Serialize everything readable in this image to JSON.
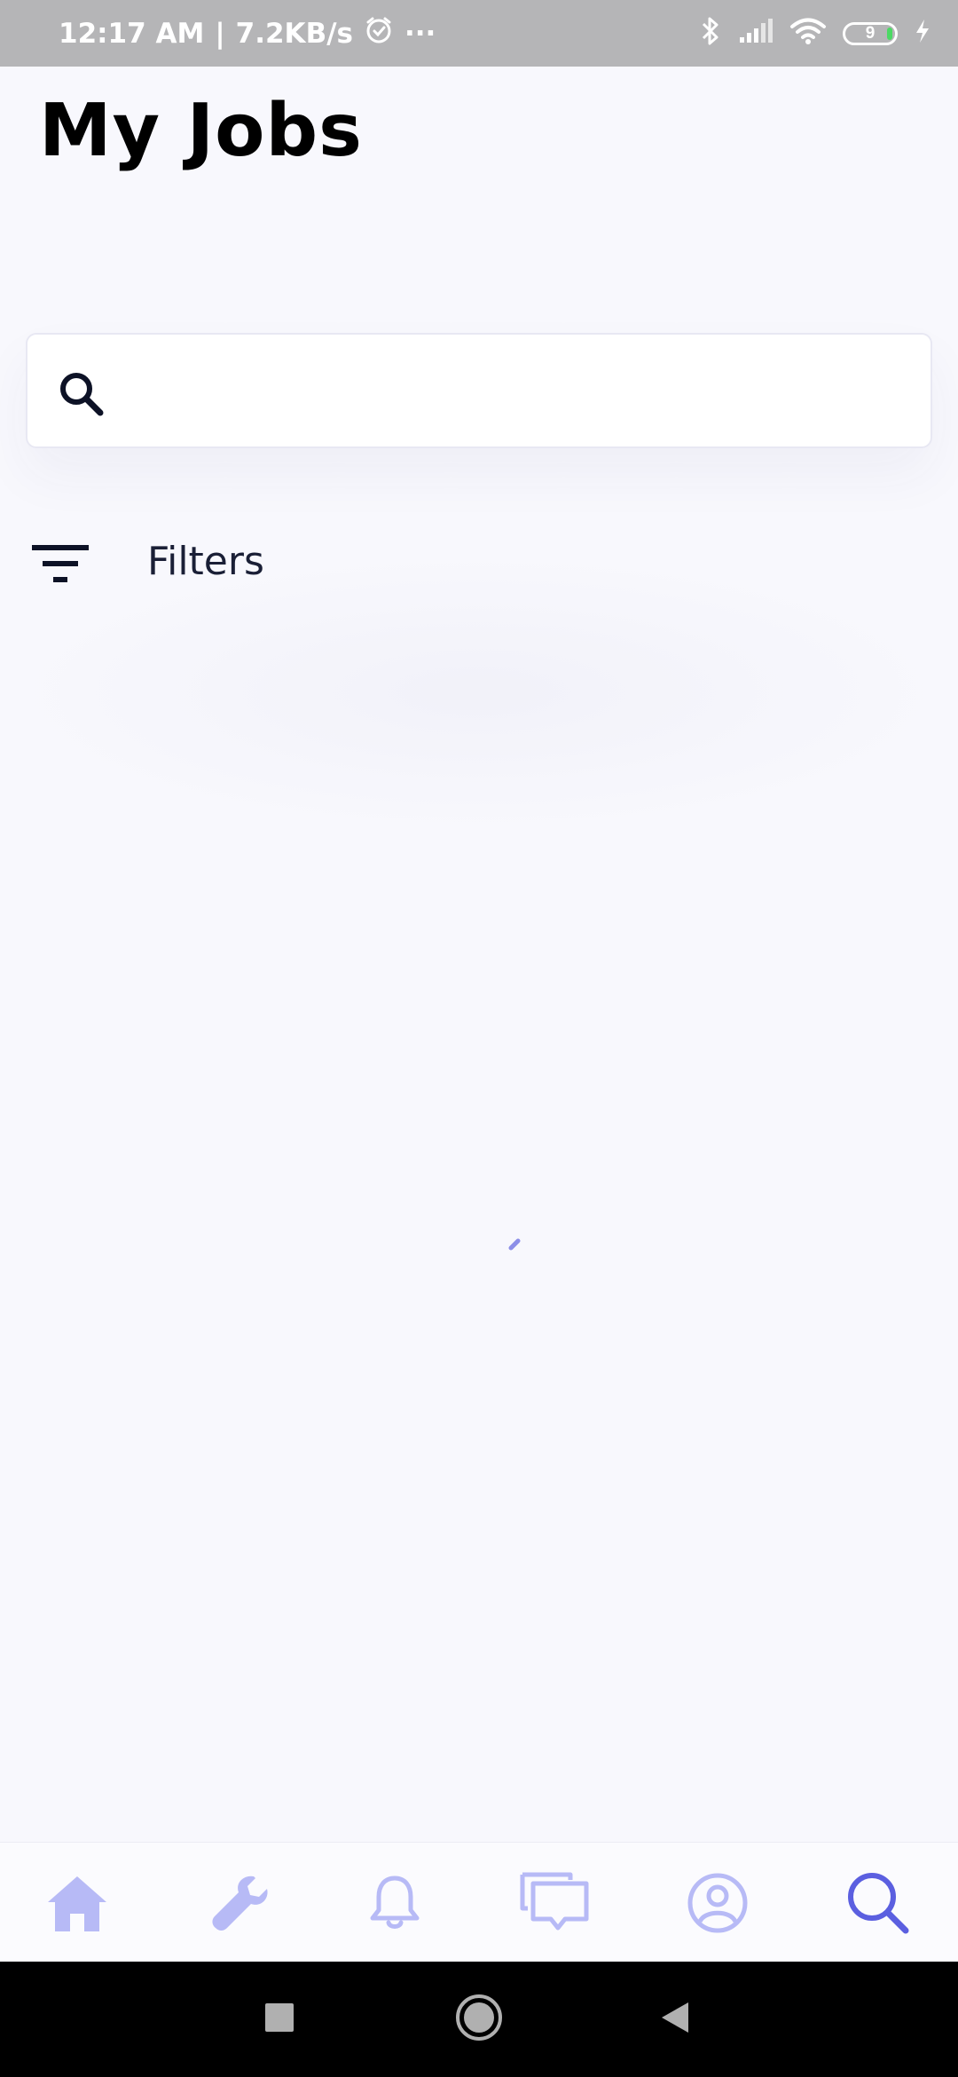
{
  "status_bar": {
    "time": "12:17 AM",
    "separator": "|",
    "network_speed": "7.2KB/s",
    "overflow": "···",
    "battery_level": "9",
    "icons": [
      "alarm-icon",
      "bluetooth-icon",
      "signal-icon",
      "wifi-icon",
      "battery-icon",
      "charging-icon"
    ]
  },
  "header": {
    "title": "My Jobs"
  },
  "search": {
    "value": "",
    "placeholder": ""
  },
  "filters": {
    "label": "Filters"
  },
  "bottom_nav": {
    "items": [
      {
        "name": "home",
        "icon": "home-icon",
        "active": false
      },
      {
        "name": "tools",
        "icon": "wrench-icon",
        "active": false
      },
      {
        "name": "notifications",
        "icon": "bell-icon",
        "active": false
      },
      {
        "name": "messages",
        "icon": "chat-icon",
        "active": false
      },
      {
        "name": "profile",
        "icon": "profile-icon",
        "active": false
      },
      {
        "name": "search",
        "icon": "search-icon",
        "active": true
      }
    ]
  },
  "colors": {
    "background": "#f8f8fd",
    "nav_inactive": "#b7baf6",
    "nav_active": "#5b5fe0",
    "text_dark": "#1a1f36",
    "spinner": "#8c8fe8"
  }
}
